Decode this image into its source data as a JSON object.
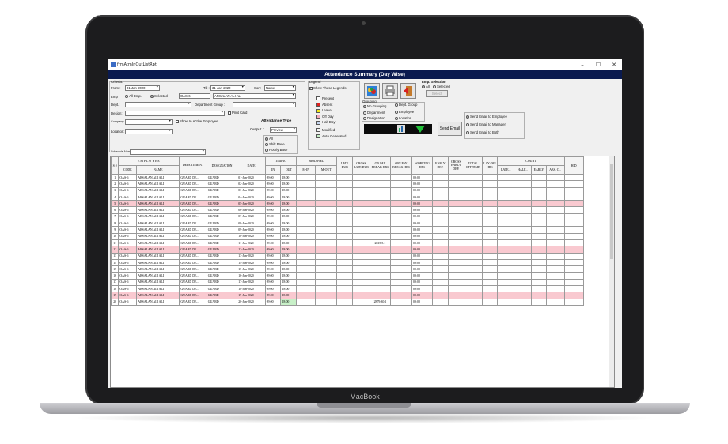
{
  "window": {
    "title": "frmAtmInOutListRpt",
    "header": "Attendance Summary (Day Wise)",
    "minimize": "–",
    "maximize": "☐",
    "close": "✕"
  },
  "brand": "MacBook",
  "criteria": {
    "group_label": "Criteria:",
    "from_label": "From :",
    "from_value": "01-Jan-2020",
    "till_label": "Till :",
    "till_value": "31-Jan-2020",
    "sort_label": "Sort:",
    "sort_value": "Name",
    "emp_label": "Emp :",
    "all_emp": "All Emp.",
    "selected": "Selected",
    "emp_code": "OAS-6",
    "emp_name": "ARSALAN ALI ALI",
    "dept_label": "Dept.:",
    "dept_group_label": "Department Group :",
    "design_label": "Design:",
    "print_card": "Print Card",
    "company_label": "Company:",
    "show_inactive": "Show In Active Employee",
    "location_label": "Location:",
    "schedule_label": "Schedule Name :"
  },
  "attendance_type": {
    "title": "Attendance Type",
    "output_label": "Output :",
    "output_value": "Preview",
    "options": [
      "All",
      "Shift Base",
      "Hourly Base"
    ]
  },
  "legend": {
    "title": "Legend",
    "show_legends": "Show These Legends",
    "items": [
      {
        "label": "Present",
        "color": "#ffffff"
      },
      {
        "label": "Absent",
        "color": "#e0201d"
      },
      {
        "label": "Leave",
        "color": "#f2e71a"
      },
      {
        "label": "Off Day",
        "color": "#f4a8b8"
      },
      {
        "label": "Half Day",
        "color": "#c6d6ef"
      },
      {
        "label": "Modified",
        "color": "#f4f4f4"
      },
      {
        "label": "Auto Generated",
        "color": "#c8f0c8"
      }
    ]
  },
  "grouping": {
    "title": "Grouping:",
    "options": [
      "No Grouping",
      "Dept. Group",
      "Department",
      "Employee",
      "Designation",
      "Location"
    ]
  },
  "emp_selection": {
    "title": "Emp. Selection",
    "all": "All",
    "selected": "Selected",
    "select_button": "Select"
  },
  "email": {
    "send_button": "Send Email",
    "options": [
      "Send Email to Employee",
      "Send Email to Manager",
      "Send Email to Both"
    ]
  },
  "table": {
    "headers": {
      "sno": "S #",
      "employee": "EMPLOYEE",
      "code": "CODE",
      "name": "NAME",
      "department": "DEPARTME NT",
      "designation": "DESIGNATION",
      "date": "DATE",
      "timing": "TIMING",
      "in": "IN",
      "out": "OUT",
      "modified": "MODIFIED",
      "m_in": "M-IN",
      "m_out": "M-OUT",
      "late_dur": "LATE DUR",
      "gross_late": "GROSS LATE DUR",
      "on_pay_break": "ON PAY BREAK HRS",
      "off_pay_break": "OFF PAY BREAK HRS",
      "working": "WORKING HRS",
      "early_dep": "EARLY DEP.",
      "gross_early": "GROSS EARLY DEP.",
      "total_off": "TOTAL OFF TIME",
      "lay_off": "LAY OFF HRS",
      "count": "COUNT",
      "late": "LATE...",
      "half": "HALF...",
      "early": "EARLY",
      "abs": "ABS. C...",
      "hid": "HID"
    },
    "rows": [
      {
        "sno": "1",
        "code": "OAS-6",
        "name": "ARSALAN ALI ALI",
        "dept": "GUARD DE...",
        "desig": "GUARD",
        "date": "01-Jan-2020",
        "in": "09:00",
        "out": "18:00",
        "on_pay": "",
        "working": "09:00",
        "hl": false
      },
      {
        "sno": "2",
        "code": "OAS-6",
        "name": "ARSALAN ALI ALI",
        "dept": "GUARD DE...",
        "desig": "GUARD",
        "date": "02-Jan-2020",
        "in": "09:00",
        "out": "18:00",
        "on_pay": "",
        "working": "09:00",
        "hl": false
      },
      {
        "sno": "3",
        "code": "OAS-6",
        "name": "ARSALAN ALI ALI",
        "dept": "GUARD DE...",
        "desig": "GUARD",
        "date": "03-Jan-2020",
        "in": "09:00",
        "out": "18:00",
        "on_pay": "",
        "working": "09:00",
        "hl": false
      },
      {
        "sno": "4",
        "code": "OAS-6",
        "name": "ARSALAN ALI ALI",
        "dept": "GUARD DE...",
        "desig": "GUARD",
        "date": "04-Jan-2020",
        "in": "09:00",
        "out": "18:00",
        "on_pay": "",
        "working": "09:00",
        "hl": false
      },
      {
        "sno": "5",
        "code": "OAS-6",
        "name": "ARSALAN ALI ALI",
        "dept": "GUARD DE...",
        "desig": "GUARD",
        "date": "05-Jan-2020",
        "in": "09:00",
        "out": "18:00",
        "on_pay": "",
        "working": "09:00",
        "hl": true
      },
      {
        "sno": "6",
        "code": "OAS-6",
        "name": "ARSALAN ALI ALI",
        "dept": "GUARD DE...",
        "desig": "GUARD",
        "date": "06-Jan-2020",
        "in": "09:00",
        "out": "18:00",
        "on_pay": "",
        "working": "09:00",
        "hl": false
      },
      {
        "sno": "7",
        "code": "OAS-6",
        "name": "ARSALAN ALI ALI",
        "dept": "GUARD DE...",
        "desig": "GUARD",
        "date": "07-Jan-2020",
        "in": "09:00",
        "out": "18:00",
        "on_pay": "",
        "working": "09:00",
        "hl": false
      },
      {
        "sno": "8",
        "code": "OAS-6",
        "name": "ARSALAN ALI ALI",
        "dept": "GUARD DE...",
        "desig": "GUARD",
        "date": "08-Jan-2020",
        "in": "09:00",
        "out": "18:00",
        "on_pay": "",
        "working": "09:00",
        "hl": false
      },
      {
        "sno": "9",
        "code": "OAS-6",
        "name": "ARSALAN ALI ALI",
        "dept": "GUARD DE...",
        "desig": "GUARD",
        "date": "09-Jan-2020",
        "in": "09:00",
        "out": "18:00",
        "on_pay": "",
        "working": "09:00",
        "hl": false
      },
      {
        "sno": "10",
        "code": "OAS-6",
        "name": "ARSALAN ALI ALI",
        "dept": "GUARD DE...",
        "desig": "GUARD",
        "date": "10-Jan-2020",
        "in": "09:00",
        "out": "18:00",
        "on_pay": "",
        "working": "09:00",
        "hl": false
      },
      {
        "sno": "11",
        "code": "OAS-6",
        "name": "ARSALAN ALI ALI",
        "dept": "GUARD DE...",
        "desig": "GUARD",
        "date": "11-Jan-2020",
        "in": "09:00",
        "out": "18:00",
        "on_pay": "2815:5:1",
        "working": "09:00",
        "hl": false
      },
      {
        "sno": "12",
        "code": "OAS-6",
        "name": "ARSALAN ALI ALI",
        "dept": "GUARD DE...",
        "desig": "GUARD",
        "date": "12-Jan-2020",
        "in": "09:00",
        "out": "18:00",
        "on_pay": "",
        "working": "09:00",
        "hl": true
      },
      {
        "sno": "13",
        "code": "OAS-6",
        "name": "ARSALAN ALI ALI",
        "dept": "GUARD DE...",
        "desig": "GUARD",
        "date": "13-Jan-2020",
        "in": "09:00",
        "out": "18:00",
        "on_pay": "",
        "working": "09:00",
        "hl": false
      },
      {
        "sno": "14",
        "code": "OAS-6",
        "name": "ARSALAN ALI ALI",
        "dept": "GUARD DE...",
        "desig": "GUARD",
        "date": "14-Jan-2020",
        "in": "09:00",
        "out": "18:00",
        "on_pay": "",
        "working": "09:00",
        "hl": false
      },
      {
        "sno": "15",
        "code": "OAS-6",
        "name": "ARSALAN ALI ALI",
        "dept": "GUARD DE...",
        "desig": "GUARD",
        "date": "15-Jan-2020",
        "in": "09:00",
        "out": "18:00",
        "on_pay": "",
        "working": "09:00",
        "hl": false
      },
      {
        "sno": "16",
        "code": "OAS-6",
        "name": "ARSALAN ALI ALI",
        "dept": "GUARD DE...",
        "desig": "GUARD",
        "date": "16-Jan-2020",
        "in": "09:00",
        "out": "18:00",
        "on_pay": "",
        "working": "09:00",
        "hl": false
      },
      {
        "sno": "17",
        "code": "OAS-6",
        "name": "ARSALAN ALI ALI",
        "dept": "GUARD DE...",
        "desig": "GUARD",
        "date": "17-Jan-2020",
        "in": "09:00",
        "out": "18:00",
        "on_pay": "",
        "working": "09:00",
        "hl": false
      },
      {
        "sno": "18",
        "code": "OAS-6",
        "name": "ARSALAN ALI ALI",
        "dept": "GUARD DE...",
        "desig": "GUARD",
        "date": "18-Jan-2020",
        "in": "09:00",
        "out": "18:00",
        "on_pay": "",
        "working": "09:00",
        "hl": false
      },
      {
        "sno": "19",
        "code": "OAS-6",
        "name": "ARSALAN ALI ALI",
        "dept": "GUARD DE...",
        "desig": "GUARD",
        "date": "19-Jan-2020",
        "in": "09:00",
        "out": "18:00",
        "on_pay": "",
        "working": "09:00",
        "hl": true
      },
      {
        "sno": "20",
        "code": "OAS-6",
        "name": "ARSALAN ALI ALI",
        "dept": "GUARD DE...",
        "desig": "GUARD",
        "date": "20-Jan-2020",
        "in": "09:00",
        "out": "18:00",
        "on_pay": "2879:30:1",
        "working": "09:00",
        "hl": false
      }
    ]
  }
}
